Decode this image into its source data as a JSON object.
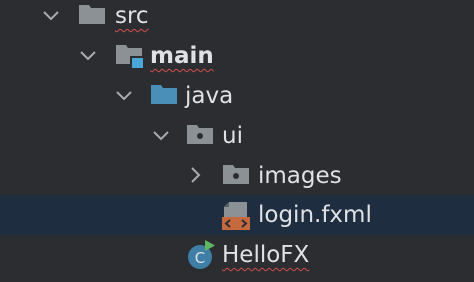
{
  "project_tree": {
    "items": [
      {
        "label": "src",
        "icon": "folder-icon",
        "expanded": true
      },
      {
        "label": "main",
        "icon": "source-root-folder-icon",
        "expanded": true
      },
      {
        "label": "java",
        "icon": "java-source-folder-icon",
        "expanded": true
      },
      {
        "label": "ui",
        "icon": "package-icon",
        "expanded": true
      },
      {
        "label": "images",
        "icon": "package-icon",
        "expanded": false
      },
      {
        "label": "login.fxml",
        "icon": "fxml-file-icon",
        "selected": true
      },
      {
        "label": "HelloFX",
        "icon": "java-class-run-icon"
      }
    ]
  },
  "colors": {
    "background": "#2b2d30",
    "selection": "#1e2e40",
    "folder": "#8c9196",
    "source_folder": "#4a8fb8",
    "class_icon": "#3f7fa6",
    "run_badge": "#5fb85f",
    "fxml_badge": "#c56a3f",
    "error_squiggle": "#d2504c"
  }
}
